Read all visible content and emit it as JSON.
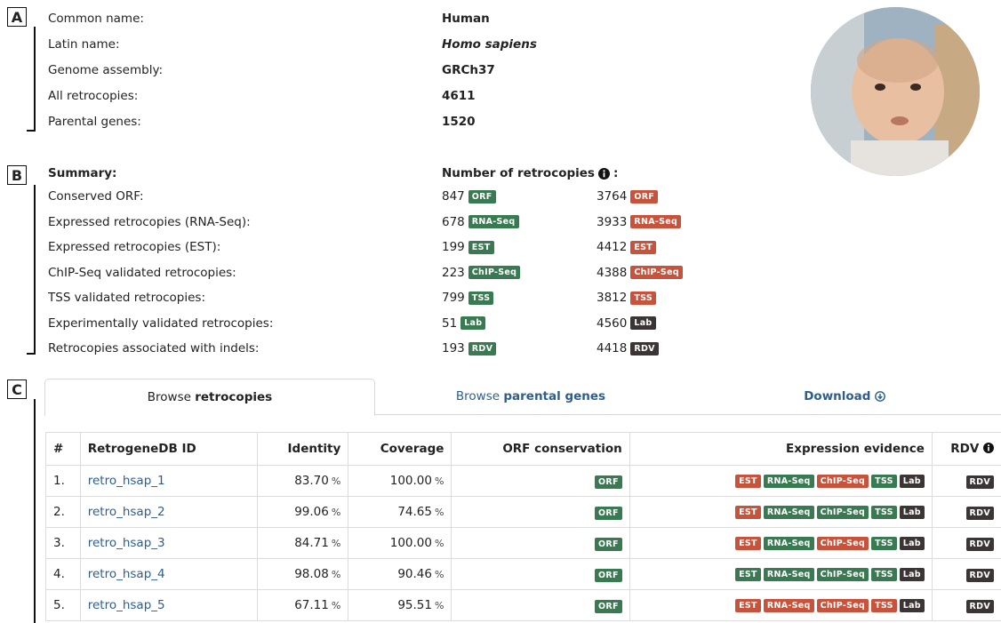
{
  "section_labels": {
    "a": "A",
    "b": "B",
    "c": "C"
  },
  "species": {
    "rows": [
      {
        "label": "Common name:",
        "value": "Human",
        "italic": false
      },
      {
        "label": "Latin name:",
        "value": "Homo sapiens",
        "italic": true
      },
      {
        "label": "Genome assembly:",
        "value": "GRCh37",
        "italic": false
      },
      {
        "label": "All retrocopies:",
        "value": "4611",
        "italic": false
      },
      {
        "label": "Parental genes:",
        "value": "1520",
        "italic": false
      }
    ]
  },
  "summary": {
    "heading": "Summary:",
    "count_heading": "Number of retrocopies",
    "info_icon": "info-circle-icon",
    "rows": [
      {
        "label": "Conserved ORF:",
        "n1": "847",
        "b1": "ORF",
        "c1": "g",
        "n2": "3764",
        "b2": "ORF",
        "c2": "r"
      },
      {
        "label": "Expressed retrocopies (RNA-Seq):",
        "n1": "678",
        "b1": "RNA-Seq",
        "c1": "g",
        "n2": "3933",
        "b2": "RNA-Seq",
        "c2": "r"
      },
      {
        "label": "Expressed retrocopies (EST):",
        "n1": "199",
        "b1": "EST",
        "c1": "g",
        "n2": "4412",
        "b2": "EST",
        "c2": "r"
      },
      {
        "label": "ChIP-Seq validated retrocopies:",
        "n1": "223",
        "b1": "ChIP-Seq",
        "c1": "g",
        "n2": "4388",
        "b2": "ChIP-Seq",
        "c2": "r"
      },
      {
        "label": "TSS validated retrocopies:",
        "n1": "799",
        "b1": "TSS",
        "c1": "g",
        "n2": "3812",
        "b2": "TSS",
        "c2": "r"
      },
      {
        "label": "Experimentally validated retrocopies:",
        "n1": "51",
        "b1": "Lab",
        "c1": "g",
        "n2": "4560",
        "b2": "Lab",
        "c2": "d"
      },
      {
        "label": "Retrocopies associated with indels:",
        "n1": "193",
        "b1": "RDV",
        "c1": "g",
        "n2": "4418",
        "b2": "RDV",
        "c2": "d"
      }
    ]
  },
  "tabs": [
    {
      "prefix": "Browse ",
      "bold": "retrocopies",
      "active": true
    },
    {
      "prefix": "Browse ",
      "bold": "parental genes",
      "active": false
    },
    {
      "prefix": "",
      "bold": "Download",
      "active": false,
      "icon": "download-circle-icon"
    }
  ],
  "table": {
    "headers": [
      "#",
      "RetrogeneDB ID",
      "Identity",
      "Coverage",
      "ORF conservation",
      "Expression evidence",
      "RDV"
    ],
    "pct": "%",
    "rows": [
      {
        "n": "1.",
        "id": "retro_hsap_1",
        "identity": "83.70",
        "coverage": "100.00",
        "orf": "ORF",
        "ev": [
          [
            "EST",
            "r"
          ],
          [
            "RNA-Seq",
            "g"
          ],
          [
            "ChIP-Seq",
            "r"
          ],
          [
            "TSS",
            "g"
          ],
          [
            "Lab",
            "d"
          ]
        ],
        "rdv": "RDV"
      },
      {
        "n": "2.",
        "id": "retro_hsap_2",
        "identity": "99.06",
        "coverage": "74.65",
        "orf": "ORF",
        "ev": [
          [
            "EST",
            "r"
          ],
          [
            "RNA-Seq",
            "g"
          ],
          [
            "ChIP-Seq",
            "g"
          ],
          [
            "TSS",
            "g"
          ],
          [
            "Lab",
            "d"
          ]
        ],
        "rdv": "RDV"
      },
      {
        "n": "3.",
        "id": "retro_hsap_3",
        "identity": "84.71",
        "coverage": "100.00",
        "orf": "ORF",
        "ev": [
          [
            "EST",
            "r"
          ],
          [
            "RNA-Seq",
            "g"
          ],
          [
            "ChIP-Seq",
            "r"
          ],
          [
            "TSS",
            "g"
          ],
          [
            "Lab",
            "d"
          ]
        ],
        "rdv": "RDV"
      },
      {
        "n": "4.",
        "id": "retro_hsap_4",
        "identity": "98.08",
        "coverage": "90.46",
        "orf": "ORF",
        "ev": [
          [
            "EST",
            "g"
          ],
          [
            "RNA-Seq",
            "g"
          ],
          [
            "ChIP-Seq",
            "g"
          ],
          [
            "TSS",
            "g"
          ],
          [
            "Lab",
            "d"
          ]
        ],
        "rdv": "RDV"
      },
      {
        "n": "5.",
        "id": "retro_hsap_5",
        "identity": "67.11",
        "coverage": "95.51",
        "orf": "ORF",
        "ev": [
          [
            "EST",
            "r"
          ],
          [
            "RNA-Seq",
            "r"
          ],
          [
            "ChIP-Seq",
            "r"
          ],
          [
            "TSS",
            "r"
          ],
          [
            "Lab",
            "d"
          ]
        ],
        "rdv": "RDV"
      }
    ]
  },
  "colors": {
    "green": "#3a7a52",
    "red": "#c8533c",
    "dark": "#3b3535",
    "link": "#2e5e8c"
  }
}
